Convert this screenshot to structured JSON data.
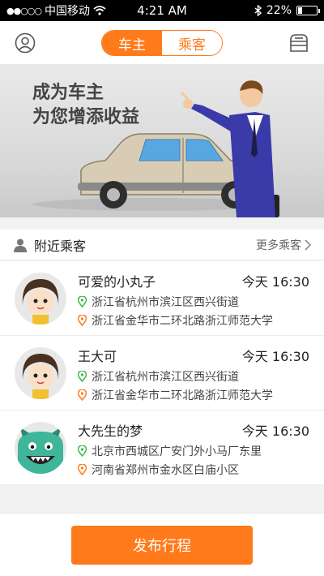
{
  "status_bar": {
    "carrier": "中国移动",
    "time": "4:21 AM",
    "battery": "22%",
    "battery_level": 0.22,
    "icons": [
      "signal-dots-icon",
      "wifi-icon",
      "bluetooth-icon",
      "battery-icon"
    ]
  },
  "nav": {
    "tabs": [
      {
        "label": "车主",
        "active": true
      },
      {
        "label": "乘客",
        "active": false
      }
    ],
    "left_icon": "user-profile-icon",
    "right_icon": "message-box-icon",
    "accent": "#ff7a1a"
  },
  "banner": {
    "line1": "成为车主",
    "line2": "为您增添收益"
  },
  "nearby": {
    "title": "附近乘客",
    "more": "更多乘客",
    "passengers": [
      {
        "name": "可爱的小丸子",
        "time": "今天 16:30",
        "from": "浙江省杭州市滨江区西兴街道",
        "to": "浙江省金华市二环北路浙江师范大学",
        "avatar": "girl"
      },
      {
        "name": "王大可",
        "time": "今天 16:30",
        "from": "浙江省杭州市滨江区西兴街道",
        "to": "浙江省金华市二环北路浙江师范大学",
        "avatar": "girl"
      },
      {
        "name": "大先生的梦",
        "time": "今天 16:30",
        "from": "北京市西城区广安门外小马厂东里",
        "to": "河南省郑州市金水区白庙小区",
        "avatar": "monster"
      }
    ]
  },
  "footer": {
    "publish_label": "发布行程"
  }
}
